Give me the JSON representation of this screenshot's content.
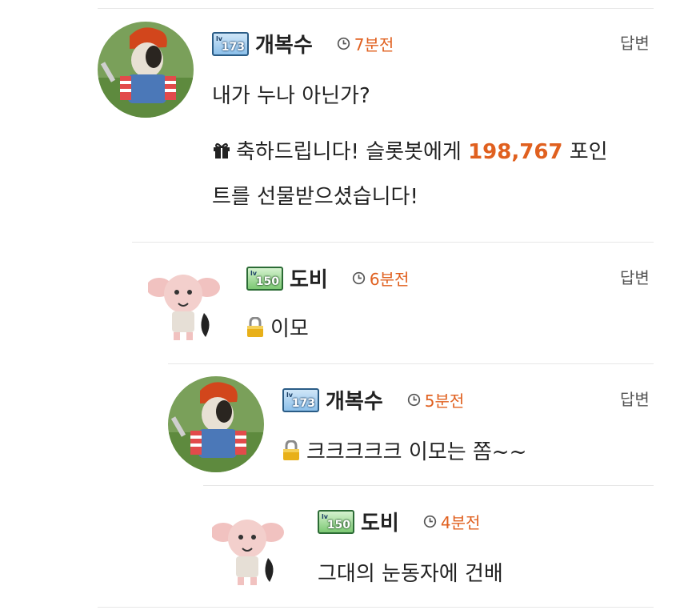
{
  "comments": [
    {
      "nickname": "개복수",
      "level": "173",
      "time": "7분전",
      "reply_label": "답변",
      "text": "내가 누나 아닌가?",
      "gift": {
        "prefix": "축하드립니다! 슬롯봇에게",
        "points": "198,767",
        "suffix_line1": "포인",
        "line2": "트를 선물받으셨습니다!"
      }
    },
    {
      "nickname": "도비",
      "level": "150",
      "time": "6분전",
      "reply_label": "답변",
      "text": "이모",
      "secret": true
    },
    {
      "nickname": "개복수",
      "level": "173",
      "time": "5분전",
      "reply_label": "답변",
      "text": "크크크크크 이모는 쫌~~",
      "secret": true
    },
    {
      "nickname": "도비",
      "level": "150",
      "time": "4분전",
      "text": "그대의 눈동자에 건배"
    }
  ],
  "icons": {
    "clock": "clock-icon",
    "lock": "lock-icon",
    "gift": "gift-icon",
    "level_badge": "level-badge-icon"
  },
  "colors": {
    "accent": "#e0601f",
    "divider": "#e6e6e6",
    "lock": "#e8b019"
  }
}
